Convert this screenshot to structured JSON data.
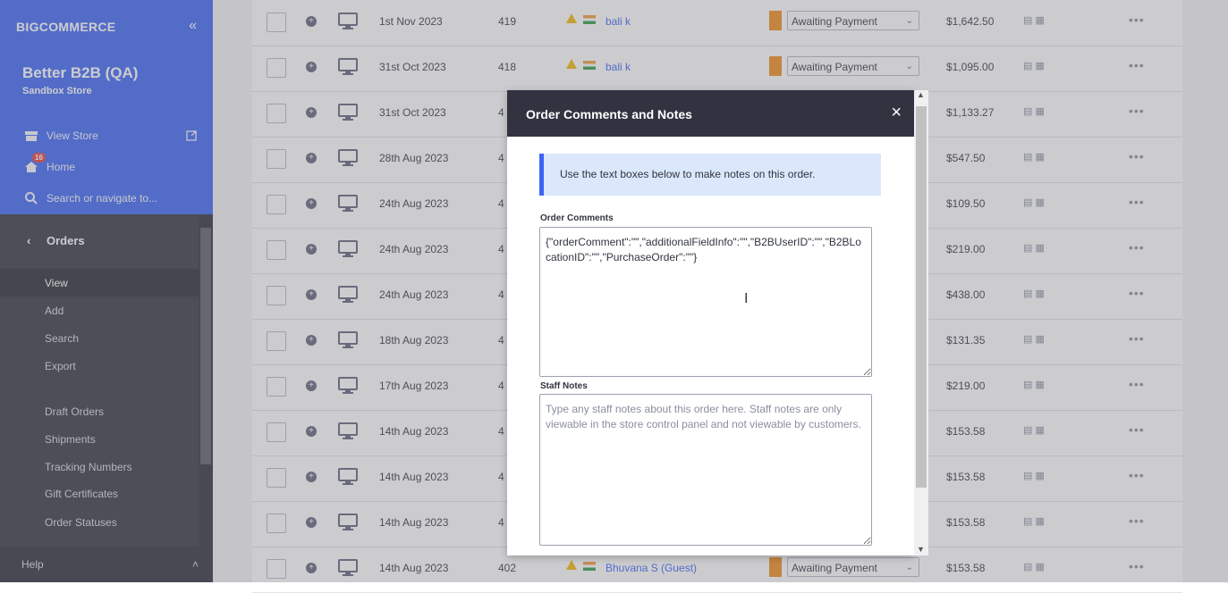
{
  "sidebar": {
    "logo": "BIGCOMMERCE",
    "store_name": "Better B2B (QA)",
    "store_sub": "Sandbox Store",
    "view_store": "View Store",
    "home": "Home",
    "home_badge": "16",
    "search": "Search or navigate to...",
    "section": "Orders",
    "items": [
      "View",
      "Add",
      "Search",
      "Export",
      "Draft Orders",
      "Shipments",
      "Tracking Numbers",
      "Gift Certificates",
      "Order Statuses"
    ],
    "help": "Help"
  },
  "orders": [
    {
      "date": "1st Nov 2023",
      "num": "419",
      "customer": "bali k",
      "status": "Awaiting Payment",
      "amount": "$1,642.50"
    },
    {
      "date": "31st Oct 2023",
      "num": "418",
      "customer": "bali k",
      "status": "Awaiting Payment",
      "amount": "$1,095.00"
    },
    {
      "date": "31st Oct 2023",
      "num": "4",
      "customer": "",
      "status": "",
      "amount": "$1,133.27"
    },
    {
      "date": "28th Aug 2023",
      "num": "4",
      "customer": "",
      "status": "",
      "amount": "$547.50"
    },
    {
      "date": "24th Aug 2023",
      "num": "4",
      "customer": "",
      "status": "",
      "amount": "$109.50"
    },
    {
      "date": "24th Aug 2023",
      "num": "4",
      "customer": "",
      "status": "",
      "amount": "$219.00"
    },
    {
      "date": "24th Aug 2023",
      "num": "4",
      "customer": "",
      "status": "",
      "amount": "$438.00"
    },
    {
      "date": "18th Aug 2023",
      "num": "4",
      "customer": "",
      "status": "",
      "amount": "$131.35"
    },
    {
      "date": "17th Aug 2023",
      "num": "4",
      "customer": "",
      "status": "",
      "amount": "$219.00"
    },
    {
      "date": "14th Aug 2023",
      "num": "4",
      "customer": "",
      "status": "",
      "amount": "$153.58"
    },
    {
      "date": "14th Aug 2023",
      "num": "4",
      "customer": "",
      "status": "",
      "amount": "$153.58"
    },
    {
      "date": "14th Aug 2023",
      "num": "4",
      "customer": "",
      "status": "",
      "amount": "$153.58"
    },
    {
      "date": "14th Aug 2023",
      "num": "402",
      "customer": "Bhuvana S (Guest)",
      "status": "Awaiting Payment",
      "amount": "$153.58"
    }
  ],
  "modal": {
    "title": "Order Comments and Notes",
    "close": "×",
    "info": "Use the text boxes below to make notes on this order.",
    "comments_label": "Order Comments",
    "comments_value": "{\"orderComment\":\"\",\"additionalFieldInfo\":\"\",\"B2BUserID\":\"\",\"B2BLocationID\":\"\",\"PurchaseOrder\":\"\"}",
    "staff_label": "Staff Notes",
    "staff_placeholder": "Type any staff notes about this order here. Staff notes are only viewable in the store control panel and not viewable by customers."
  },
  "colors": {
    "sidebar_top": "#3c64f4",
    "sidebar": "#313440",
    "status": "#f08c1a",
    "link": "#3c64f4"
  }
}
